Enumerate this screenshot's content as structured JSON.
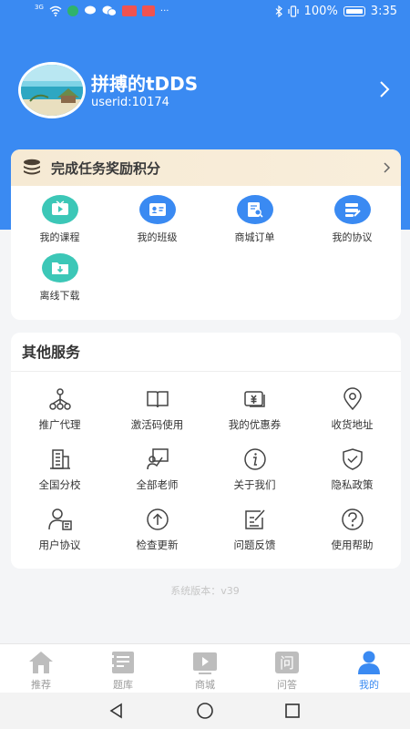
{
  "status_bar": {
    "signal": "3G",
    "battery_percent": "100%",
    "time": "3:35",
    "more": "···"
  },
  "profile": {
    "name": "拼搏的tDDS",
    "userid": "userid:10174"
  },
  "task_banner": {
    "label": "完成任务奖励积分"
  },
  "my_items": [
    {
      "label": "我的课程",
      "icon": "video-icon",
      "color": "#3cc7b7"
    },
    {
      "label": "我的班级",
      "icon": "id-card-icon",
      "color": "#3a8af2"
    },
    {
      "label": "商城订单",
      "icon": "order-search-icon",
      "color": "#3a8af2"
    },
    {
      "label": "我的协议",
      "icon": "agreement-icon",
      "color": "#3a8af2"
    },
    {
      "label": "离线下载",
      "icon": "download-folder-icon",
      "color": "#3cc7b7"
    }
  ],
  "services": {
    "title": "其他服务",
    "items": [
      {
        "label": "推广代理",
        "icon": "org-chart-icon"
      },
      {
        "label": "激活码使用",
        "icon": "book-icon"
      },
      {
        "label": "我的优惠券",
        "icon": "coupon-icon"
      },
      {
        "label": "收货地址",
        "icon": "location-pin-icon"
      },
      {
        "label": "全国分校",
        "icon": "building-icon"
      },
      {
        "label": "全部老师",
        "icon": "teacher-board-icon"
      },
      {
        "label": "关于我们",
        "icon": "info-icon"
      },
      {
        "label": "隐私政策",
        "icon": "shield-check-icon"
      },
      {
        "label": "用户协议",
        "icon": "user-doc-icon"
      },
      {
        "label": "检查更新",
        "icon": "upload-circle-icon"
      },
      {
        "label": "问题反馈",
        "icon": "feedback-edit-icon"
      },
      {
        "label": "使用帮助",
        "icon": "help-circle-icon"
      }
    ]
  },
  "version_text": "系统版本：v39",
  "tabs": [
    {
      "label": "推荐",
      "icon": "home-icon",
      "active": false
    },
    {
      "label": "题库",
      "icon": "question-bank-icon",
      "active": false
    },
    {
      "label": "商城",
      "icon": "shop-video-icon",
      "active": false
    },
    {
      "label": "问答",
      "icon": "qa-icon",
      "active": false
    },
    {
      "label": "我的",
      "icon": "user-icon",
      "active": true
    }
  ],
  "colors": {
    "primary": "#3a8af2",
    "teal": "#3cc7b7",
    "banner": "#f6ead4",
    "tab_inactive": "#bdbdbd"
  }
}
